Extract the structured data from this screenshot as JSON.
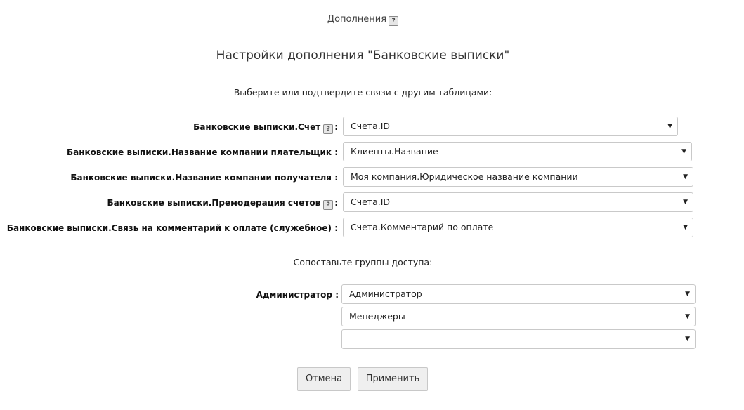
{
  "header": {
    "breadcrumb": "Дополнения",
    "help_glyph": "?",
    "title": "Настройки дополнения \"Банковские выписки\""
  },
  "links_section": {
    "prompt": "Выберите или подтвердите связи с другим таблицами:",
    "rows": [
      {
        "label": "Банковские выписки.Счет",
        "has_help": true,
        "value": "Счета.ID"
      },
      {
        "label": "Банковские выписки.Название компании плательщик",
        "has_help": false,
        "value": "Клиенты.Название"
      },
      {
        "label": "Банковские выписки.Название компании получателя",
        "has_help": false,
        "value": "Моя компания.Юридическое название компании"
      },
      {
        "label": "Банковские выписки.Премодерация счетов",
        "has_help": true,
        "value": "Счета.ID"
      },
      {
        "label": "Банковские выписки.Связь на комментарий к оплате (служебное)",
        "has_help": false,
        "value": "Счета.Комментарий по оплате"
      }
    ],
    "colon": ":"
  },
  "access_section": {
    "prompt": "Сопоставьте группы доступа:",
    "label": "Администратор :",
    "values": [
      "Администратор",
      "Менеджеры",
      ""
    ]
  },
  "dropdown_arrow": "▼",
  "buttons": {
    "cancel": "Отмена",
    "apply": "Применить"
  }
}
